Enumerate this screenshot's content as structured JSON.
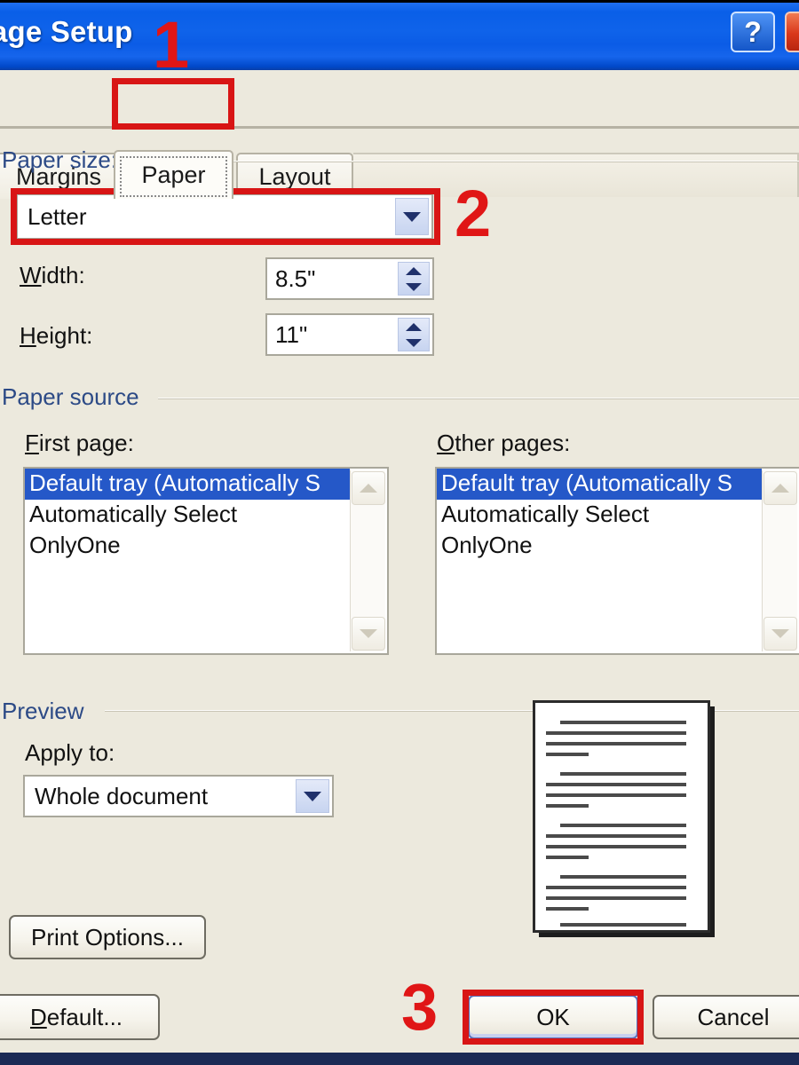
{
  "window": {
    "title": "age Setup",
    "full_title": "Page Setup",
    "help_button": "?",
    "close_button": "✕"
  },
  "tabs": [
    {
      "label": "Margins",
      "active": false
    },
    {
      "label": "Paper",
      "active": true
    },
    {
      "label": "Layout",
      "active": false
    }
  ],
  "paper_size": {
    "group_label": "Paper size:",
    "combo_value": "Letter",
    "width": {
      "label": "Width:",
      "label_prefix": "W",
      "label_rest": "idth:",
      "value": "8.5\""
    },
    "height": {
      "label": "Height:",
      "label_prefix": "H",
      "label_rest": "eight:",
      "value": "11\""
    }
  },
  "paper_source": {
    "group_label": "Paper source",
    "first_page": {
      "label": "First page:",
      "label_prefix": "F",
      "label_rest": "irst page:",
      "items": [
        "Default tray (Automatically S",
        "Automatically Select",
        "OnlyOne"
      ],
      "selected_index": 0
    },
    "other_pages": {
      "label": "Other pages:",
      "label_prefix": "O",
      "label_rest": "ther pages:",
      "items": [
        "Default tray (Automatically S",
        "Automatically Select",
        "OnlyOne"
      ],
      "selected_index": 0
    }
  },
  "preview": {
    "group_label": "Preview",
    "apply_to_label": "Apply to:",
    "apply_to_value": "Whole document",
    "print_options_label": "Print Options..."
  },
  "buttons": {
    "default_label": "Default...",
    "default_prefix": "D",
    "default_rest": "efault...",
    "ok_label": "OK",
    "cancel_label": "Cancel"
  },
  "annotations": {
    "step1": "1",
    "step2": "2",
    "step3": "3"
  },
  "colors": {
    "titlebar_blue": "#0a5fe8",
    "dialog_bg": "#ece9dd",
    "annotation_red": "#d81515",
    "selection_blue": "#2558c8",
    "group_label_blue": "#2c4a86"
  }
}
